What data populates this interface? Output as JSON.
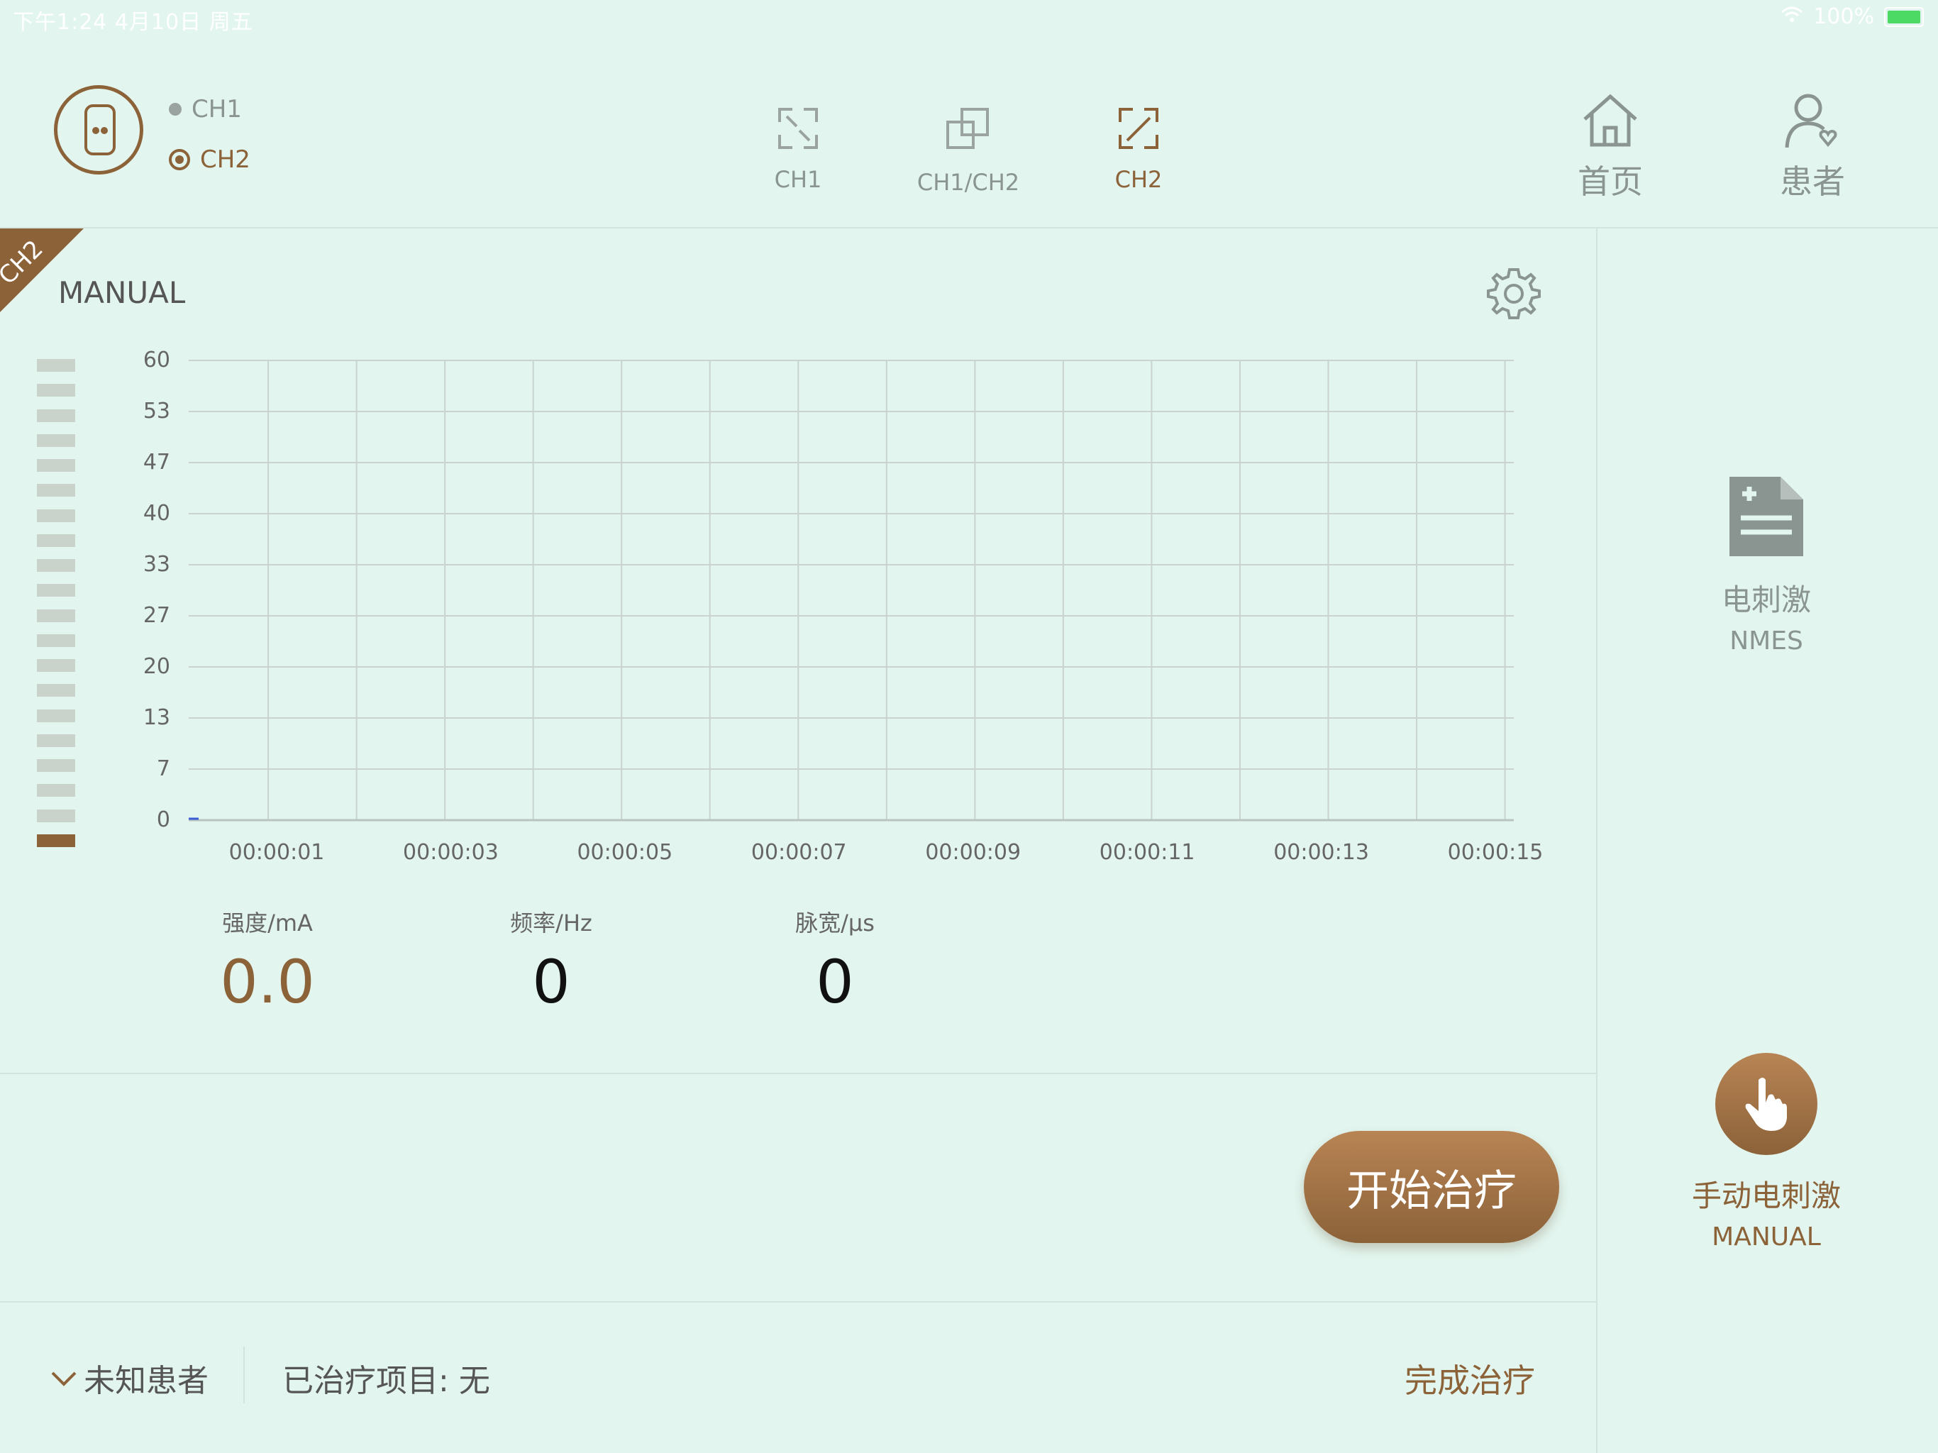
{
  "status_bar": {
    "time_date": "下午1:24   4月10日 周五",
    "battery": "100%"
  },
  "header": {
    "channels": [
      {
        "label": "CH1",
        "selected": false
      },
      {
        "label": "CH2",
        "selected": true
      }
    ],
    "view_modes": [
      {
        "label": "CH1"
      },
      {
        "label": "CH1/CH2"
      },
      {
        "label": "CH2",
        "active": true
      }
    ],
    "nav": {
      "home": "首页",
      "patient": "患者"
    }
  },
  "panel": {
    "channel_badge": "CH2",
    "mode_title": "MANUAL",
    "level_bars": {
      "total": 20,
      "active": 1
    },
    "chart_data": {
      "type": "line",
      "y_ticks": [
        "60",
        "53",
        "47",
        "40",
        "33",
        "27",
        "20",
        "13",
        "7",
        "0"
      ],
      "x_ticks": [
        "00:00:01",
        "00:00:03",
        "00:00:05",
        "00:00:07",
        "00:00:09",
        "00:00:11",
        "00:00:13",
        "00:00:15"
      ],
      "ylim": [
        0,
        60
      ],
      "grid": true,
      "series": []
    },
    "metrics": [
      {
        "label": "强度/mA",
        "value": "0.0"
      },
      {
        "label": "频率/Hz",
        "value": "0"
      },
      {
        "label": "脉宽/μs",
        "value": "0"
      }
    ],
    "start_button": "开始治疗"
  },
  "footer": {
    "patient": "未知患者",
    "treated_label": "已治疗项目:",
    "treated_value": "无",
    "finish": "完成治疗"
  },
  "sidebar": {
    "items": [
      {
        "cn": "电刺激",
        "en": "NMES",
        "active": false
      },
      {
        "cn": "手动电刺激",
        "en": "MANUAL",
        "active": true
      }
    ]
  },
  "colors": {
    "accent": "#8c6239",
    "background": "#e2f5ee",
    "grid": "#c9d3cf"
  }
}
